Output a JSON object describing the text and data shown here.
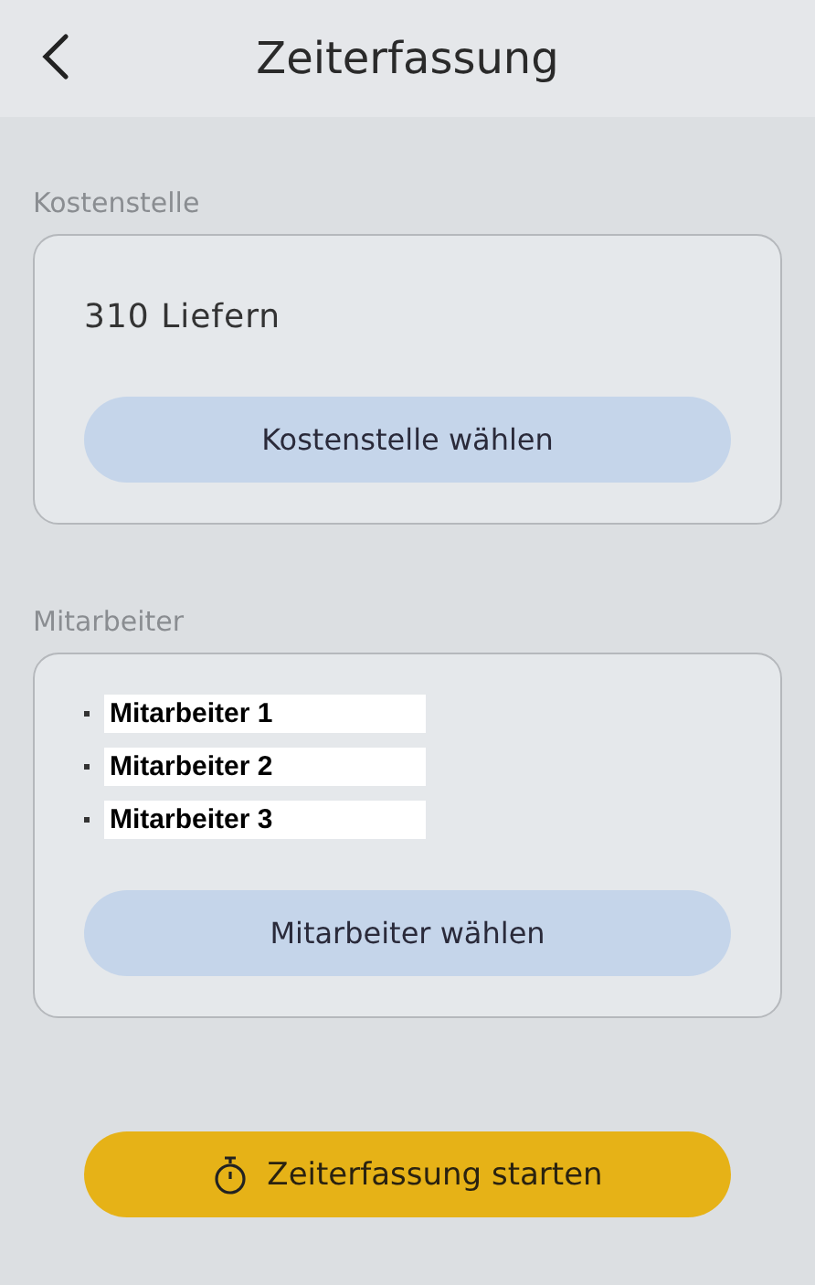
{
  "header": {
    "title": "Zeiterfassung"
  },
  "cost_center": {
    "label": "Kostenstelle",
    "value": "310 Liefern",
    "button": "Kostenstelle wählen"
  },
  "employees": {
    "label": "Mitarbeiter",
    "items": [
      "Mitarbeiter 1",
      "Mitarbeiter 2",
      "Mitarbeiter 3"
    ],
    "button": "Mitarbeiter wählen"
  },
  "start_button": "Zeiterfassung starten"
}
